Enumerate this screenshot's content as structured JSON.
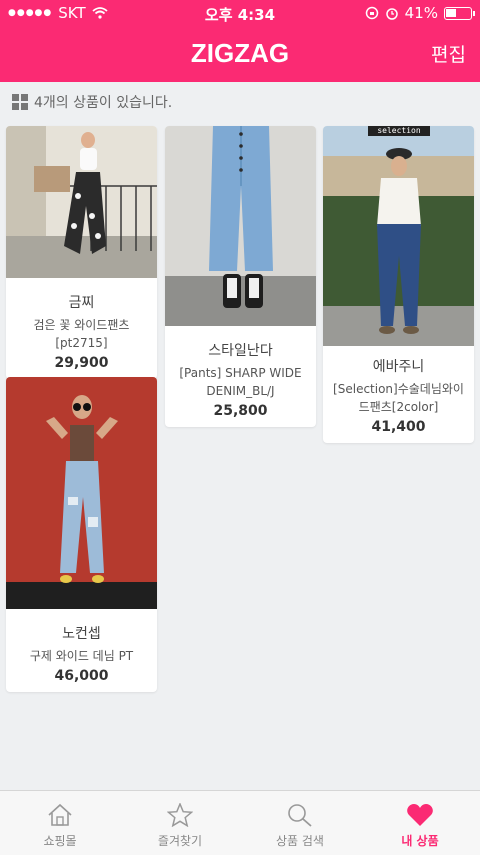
{
  "status": {
    "carrier": "SKT",
    "time": "오후 4:34",
    "battery": "41%"
  },
  "header": {
    "logo": "ZIGZAG",
    "edit_label": "편집"
  },
  "summary": {
    "count_text": "4개의 상품이 있습니다."
  },
  "products": [
    {
      "store": "금찌",
      "name": "검은 꽃 와이드팬츠",
      "name2": "[pt2715]",
      "price": "29,900"
    },
    {
      "store": "스타일난다",
      "name": "[Pants] SHARP WIDE",
      "name2": "DENIM_BL/J",
      "price": "25,800"
    },
    {
      "store": "에바주니",
      "badge": "selection",
      "name": "[Selection]수술데님와이",
      "name2": "드팬츠[2color]",
      "price": "41,400"
    },
    {
      "store": "노컨셉",
      "name": "구제 와이드 데님 PT",
      "name2": "",
      "price": "46,000"
    }
  ],
  "tabbar": {
    "tabs": [
      {
        "label": "쇼핑몰"
      },
      {
        "label": "즐겨찾기"
      },
      {
        "label": "상품 검색"
      },
      {
        "label": "내 상품"
      }
    ]
  },
  "colors": {
    "accent": "#fb2a73"
  }
}
